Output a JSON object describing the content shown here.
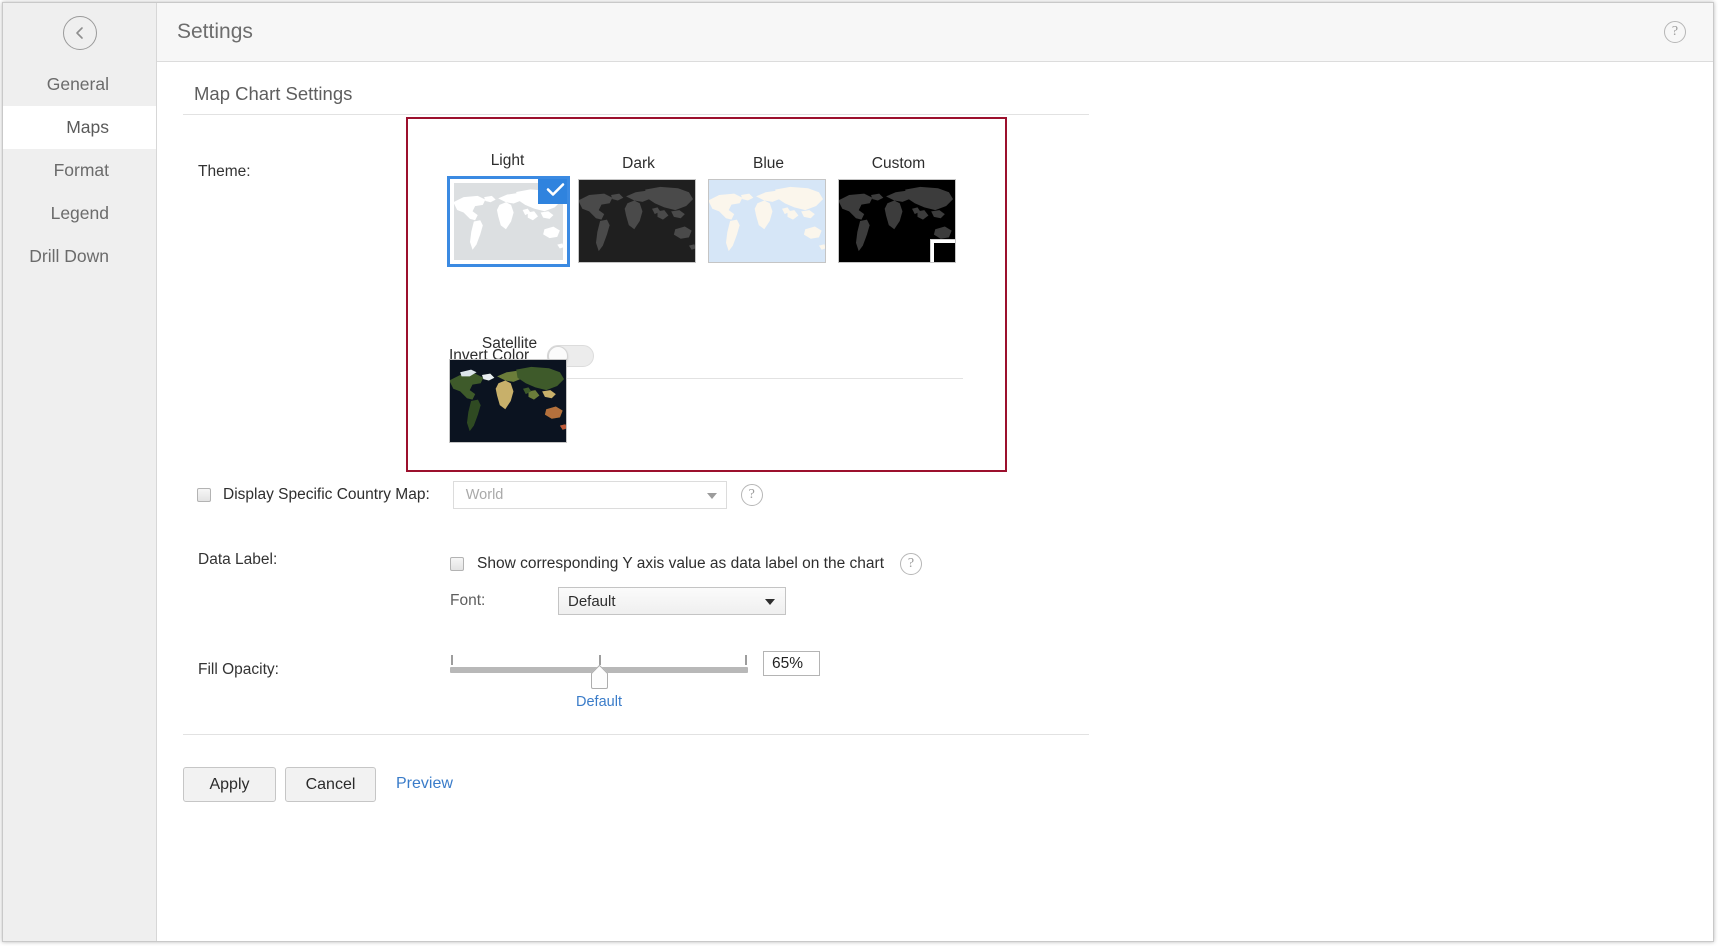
{
  "window": {
    "header": {
      "title": "Settings",
      "help_icon": "help-circle-icon",
      "help_glyph": "?"
    },
    "back_icon": "chevron-left-circle-icon"
  },
  "sidebar": {
    "items": [
      {
        "label": "General",
        "active": false
      },
      {
        "label": "Maps",
        "active": true
      },
      {
        "label": "Format",
        "active": false
      },
      {
        "label": "Legend",
        "active": false
      },
      {
        "label": "Drill Down",
        "active": false
      }
    ]
  },
  "main": {
    "section_title": "Map Chart Settings",
    "theme": {
      "label": "Theme:",
      "options": [
        {
          "name": "Light",
          "selected": true,
          "bg": "#dcdfe1",
          "land": "#ffffff"
        },
        {
          "name": "Dark",
          "selected": false,
          "bg": "#1f1f1f",
          "land": "#4a4a4a"
        },
        {
          "name": "Blue",
          "selected": false,
          "bg": "#d6e6f7",
          "land": "#fbf6ec"
        },
        {
          "name": "Custom",
          "selected": false,
          "bg": "#000000",
          "land": "#3c3c3c"
        }
      ],
      "selected_check_icon": "check-icon",
      "custom_swatch_color": "#000000",
      "invert_color": {
        "label": "Invert Color",
        "enabled": false
      },
      "satellite": {
        "name": "Satellite",
        "bg": "#0b1320"
      }
    },
    "country_map": {
      "checkbox_checked": false,
      "label": "Display Specific Country Map:",
      "selected_value": "World",
      "help_glyph": "?"
    },
    "data_label": {
      "label": "Data Label:",
      "checkbox_checked": false,
      "checkbox_text": "Show corresponding Y axis value as data label on the chart",
      "help_glyph": "?",
      "font_label": "Font:",
      "font_value": "Default"
    },
    "fill_opacity": {
      "label": "Fill Opacity:",
      "value_text": "65%",
      "value_percent": 65,
      "default_marker_label": "Default",
      "default_marker_percent": 50,
      "ticks_percent": [
        0,
        50,
        100
      ],
      "min": 0,
      "max": 100
    },
    "footer": {
      "apply_label": "Apply",
      "cancel_label": "Cancel",
      "preview_label": "Preview"
    }
  },
  "colors": {
    "accent_blue": "#3b8ae2",
    "link_blue": "#3a7cc9",
    "highlight_border": "#9c102d",
    "sidebar_bg": "#efefef",
    "header_bg": "#f7f7f7"
  }
}
